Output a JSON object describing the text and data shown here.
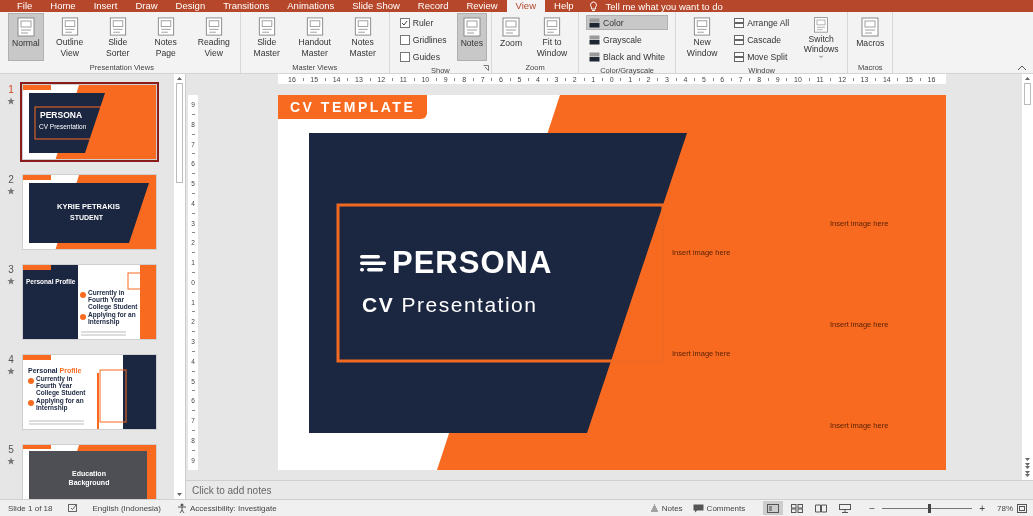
{
  "window": {
    "tabs": [
      {
        "label": "File",
        "selected": false
      },
      {
        "label": "Home",
        "selected": false
      },
      {
        "label": "Insert",
        "selected": false
      },
      {
        "label": "Draw",
        "selected": false
      },
      {
        "label": "Design",
        "selected": false
      },
      {
        "label": "Transitions",
        "selected": false
      },
      {
        "label": "Animations",
        "selected": false
      },
      {
        "label": "Slide Show",
        "selected": false
      },
      {
        "label": "Record",
        "selected": false
      },
      {
        "label": "Review",
        "selected": false
      },
      {
        "label": "View",
        "selected": true
      },
      {
        "label": "Help",
        "selected": false
      }
    ],
    "tell_me": "Tell me what you want to do"
  },
  "ribbon": {
    "groups": [
      {
        "label": "Presentation Views",
        "items": [
          {
            "kind": "large",
            "label": "Normal",
            "selected": true
          },
          {
            "kind": "large",
            "label": "Outline View",
            "selected": false
          },
          {
            "kind": "large",
            "label": "Slide Sorter",
            "selected": false
          },
          {
            "kind": "large",
            "label": "Notes Page",
            "selected": false
          },
          {
            "kind": "large",
            "label": "Reading View",
            "selected": false
          }
        ]
      },
      {
        "label": "Master Views",
        "items": [
          {
            "kind": "large",
            "label": "Slide Master",
            "selected": false
          },
          {
            "kind": "large",
            "label": "Handout Master",
            "selected": false
          },
          {
            "kind": "large",
            "label": "Notes Master",
            "selected": false
          }
        ]
      },
      {
        "label": "Show",
        "launcher": true,
        "items": [
          {
            "kind": "check",
            "label": "Ruler",
            "checked": true
          },
          {
            "kind": "check",
            "label": "Gridlines",
            "checked": false
          },
          {
            "kind": "check",
            "label": "Guides",
            "checked": false
          },
          {
            "kind": "large",
            "label": "Notes",
            "selected": true
          }
        ]
      },
      {
        "label": "Zoom",
        "items": [
          {
            "kind": "large",
            "label": "Zoom",
            "selected": false
          },
          {
            "kind": "large",
            "label": "Fit to Window",
            "selected": false
          }
        ]
      },
      {
        "label": "Color/Grayscale",
        "items": [
          {
            "kind": "swatch",
            "label": "Color",
            "selected": true
          },
          {
            "kind": "swatch",
            "label": "Grayscale",
            "selected": false
          },
          {
            "kind": "swatch",
            "label": "Black and White",
            "selected": false
          }
        ]
      },
      {
        "label": "Window",
        "items": [
          {
            "kind": "large",
            "label": "New Window",
            "selected": false
          },
          {
            "kind": "small",
            "label": "Arrange All"
          },
          {
            "kind": "small",
            "label": "Cascade"
          },
          {
            "kind": "small",
            "label": "Move Split"
          },
          {
            "kind": "large",
            "label": "Switch Windows",
            "selected": false,
            "dropdown": true
          }
        ]
      },
      {
        "label": "Macros",
        "items": [
          {
            "kind": "large",
            "label": "Macros",
            "selected": false
          }
        ]
      }
    ]
  },
  "slides_pane": {
    "slides": [
      {
        "number": "1",
        "selected": true,
        "kind": "title",
        "title": "PERSONA",
        "subtitle": "CV Presentation"
      },
      {
        "number": "2",
        "selected": false,
        "kind": "name",
        "title": "KYRIE PETRAKIS",
        "subtitle": "STUDENT"
      },
      {
        "number": "3",
        "selected": false,
        "kind": "profile",
        "title": "Personal Profile",
        "items": [
          "Currently in Fourth Year College Student",
          "Applying for an Internship"
        ]
      },
      {
        "number": "4",
        "selected": false,
        "kind": "profile_alt",
        "title": "Personal",
        "title_accent": "Profile",
        "items": [
          "Currently in Fourth Year College Student",
          "Applying for an Internship"
        ]
      },
      {
        "number": "5",
        "selected": false,
        "kind": "section",
        "title": "Education Background"
      }
    ]
  },
  "rulers": {
    "horizontal": [
      "16",
      "15",
      "14",
      "13",
      "12",
      "11",
      "10",
      "9",
      "8",
      "7",
      "6",
      "5",
      "4",
      "3",
      "2",
      "1",
      "0",
      "1",
      "2",
      "3",
      "4",
      "5",
      "6",
      "7",
      "8",
      "9",
      "10",
      "11",
      "12",
      "13",
      "14",
      "15",
      "16"
    ],
    "vertical": [
      "9",
      "8",
      "7",
      "6",
      "5",
      "4",
      "3",
      "2",
      "1",
      "0",
      "1",
      "2",
      "3",
      "4",
      "5",
      "6",
      "7",
      "8",
      "9"
    ]
  },
  "slide": {
    "tag": "CV TEMPLATE",
    "title": "PERSONA",
    "subtitle": "**CV** Presentation",
    "placeholders": [
      "Insert image here",
      "Insert image here",
      "Insert image here",
      "Insert image here",
      "Insert image here"
    ]
  },
  "notes": {
    "placeholder": "Click to add notes"
  },
  "status_bar": {
    "slide": "Slide 1 of 18",
    "language": "English (Indonesia)",
    "accessibility": "Accessibility: Investigate",
    "notes": "Notes",
    "comments": "Comments",
    "views": [
      {
        "selected": true
      },
      {
        "selected": false
      },
      {
        "selected": false
      },
      {
        "selected": false
      }
    ],
    "zoom": {
      "minus": "−",
      "plus": "+",
      "level": 0.52,
      "reading": "78%"
    }
  }
}
